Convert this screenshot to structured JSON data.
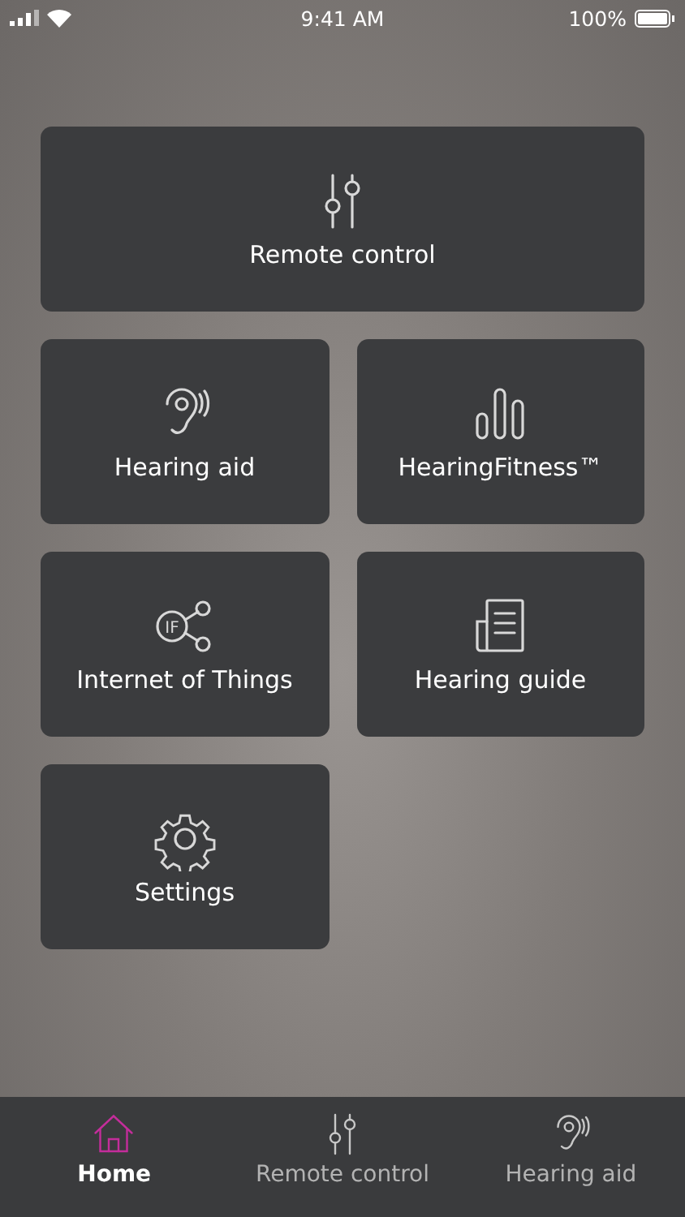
{
  "status_bar": {
    "time": "9:41 AM",
    "battery": "100%"
  },
  "tiles": [
    {
      "label": "Remote control",
      "kind": "sliders",
      "wide": true
    },
    {
      "label": "Hearing aid",
      "kind": "ear",
      "wide": false
    },
    {
      "label": "HearingFitness™",
      "kind": "bars",
      "wide": false
    },
    {
      "label": "Internet of Things",
      "kind": "iot",
      "icon_text": "IF",
      "wide": false
    },
    {
      "label": "Hearing guide",
      "kind": "document",
      "wide": false
    },
    {
      "label": "Settings",
      "kind": "gear",
      "wide": false
    }
  ],
  "tab_bar": [
    {
      "label": "Home",
      "kind": "home",
      "selected": true
    },
    {
      "label": "Remote control",
      "kind": "sliders",
      "selected": false
    },
    {
      "label": "Hearing aid",
      "kind": "ear",
      "selected": false
    }
  ]
}
